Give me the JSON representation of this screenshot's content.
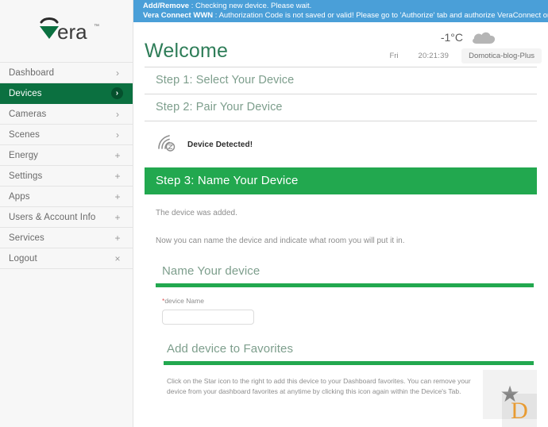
{
  "notice": {
    "line1_key": "Add/Remove",
    "line1_sep": " : ",
    "line1_text": "Checking new device. Please wait.",
    "line2_key": "Vera Connect WWN",
    "line2_sep": " : ",
    "line2_text": "Authorization Code is not saved or valid! Please go to 'Authorize' tab and authorize VeraConnect once again!",
    "bg_color": "#4a9fd8"
  },
  "sidebar": {
    "logo_text": "vera",
    "logo_tm": "™",
    "items": [
      {
        "label": "Dashboard",
        "mark": "›",
        "mark_name": "chevron-right-icon",
        "active": false
      },
      {
        "label": "Devices",
        "mark": "›",
        "mark_name": "chevron-right-icon",
        "active": true
      },
      {
        "label": "Cameras",
        "mark": "›",
        "mark_name": "chevron-right-icon",
        "active": false
      },
      {
        "label": "Scenes",
        "mark": "›",
        "mark_name": "chevron-right-icon",
        "active": false
      },
      {
        "label": "Energy",
        "mark": "+",
        "mark_name": "plus-icon",
        "active": false
      },
      {
        "label": "Settings",
        "mark": "+",
        "mark_name": "plus-icon",
        "active": false
      },
      {
        "label": "Apps",
        "mark": "+",
        "mark_name": "plus-icon",
        "active": false
      },
      {
        "label": "Users & Account Info",
        "mark": "+",
        "mark_name": "plus-icon",
        "active": false
      },
      {
        "label": "Services",
        "mark": "+",
        "mark_name": "plus-icon",
        "active": false
      },
      {
        "label": "Logout",
        "mark": "×",
        "mark_name": "close-icon",
        "active": false
      }
    ],
    "active_color": "#0b7040"
  },
  "header": {
    "title": "Welcome",
    "title_color": "#2e7d58",
    "weather": {
      "temperature": "-1°C",
      "icon": "cloud-icon"
    },
    "day": "Fri",
    "time": "20:21:39",
    "unit_name": "Domotica-blog-Plus"
  },
  "steps": {
    "step1": "Step 1: Select Your Device",
    "step2": "Step 2: Pair Your Device",
    "step3": "Step 3: Name Your Device",
    "step3_color": "#22a84f"
  },
  "detect": {
    "icon": "wireless-signal-icon",
    "label": "Device Detected!"
  },
  "body": {
    "added_text": "The device was added.",
    "instruction_text": "Now you can name the device and indicate what room you will put it in."
  },
  "name_section": {
    "title": "Name Your device",
    "field_required_mark": "*",
    "field_label": "device Name",
    "field_value": "",
    "field_placeholder": ""
  },
  "favorites_section": {
    "title": "Add device to Favorites",
    "description": "Click on the Star icon to the right to add this device to your Dashboard favorites. You can remove your device from your dashboard favorites at anytime by clicking this icon again within the Device's Tab.",
    "star_icon": "star-icon",
    "overlay_letter": "D",
    "overlay_color": "#e89b32"
  }
}
